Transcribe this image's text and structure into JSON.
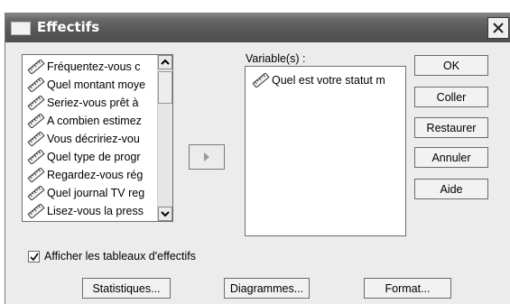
{
  "window": {
    "title": "Effectifs"
  },
  "source_list": {
    "items": [
      "Fréquentez-vous c",
      "Quel montant moye",
      "Seriez-vous prêt à",
      "A combien estimez",
      "Vous décririez-vou",
      "Quel type de progr",
      "Regardez-vous rég",
      "Quel journal TV reg",
      "Lisez-vous la press"
    ]
  },
  "variables": {
    "label": "Variable(s) :",
    "items": [
      "Quel est votre statut m"
    ]
  },
  "buttons": {
    "ok": "OK",
    "paste": "Coller",
    "reset": "Restaurer",
    "cancel": "Annuler",
    "help": "Aide",
    "statistics": "Statistiques...",
    "charts": "Diagrammes...",
    "format": "Format..."
  },
  "options": {
    "display_tables_label": "Afficher les tableaux d'effectifs",
    "display_tables_checked": true
  },
  "icons": {
    "variable": "ruler-scale-icon",
    "move": "arrow-right-icon",
    "close": "close-icon",
    "window": "window-icon"
  }
}
